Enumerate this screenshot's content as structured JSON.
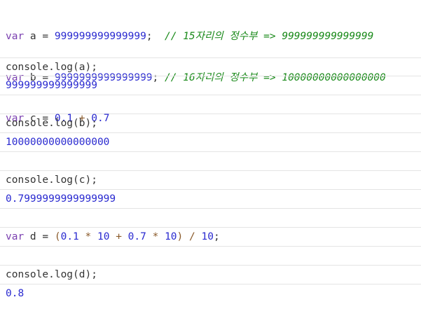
{
  "code": {
    "line_a": {
      "kw": "var",
      "name": " a = ",
      "value": "999999999999999",
      "semi": ";  ",
      "comment": "// 15자리의 정수부 => 999999999999999"
    },
    "line_b": {
      "kw": "var",
      "name": " b = ",
      "value": "9999999999999999",
      "semi": "; ",
      "comment": "// 16자리의 정수부 => 10000000000000000"
    },
    "line_c": {
      "kw": "var",
      "name": " c = ",
      "v1": "0.1",
      "op": " + ",
      "v2": "0.7"
    }
  },
  "console_entries": [
    {
      "input": "console.log(a);",
      "output": "999999999999999"
    },
    {
      "input": "console.log(b);",
      "output": "10000000000000000"
    },
    {
      "input": "console.log(c);",
      "output": "0.7999999999999999"
    }
  ],
  "code_d": {
    "kw": "var",
    "name": " d = ",
    "p1": "(",
    "v1": "0.1",
    "o1": " * ",
    "v2": "10",
    "o2": " + ",
    "v3": "0.7",
    "o3": " * ",
    "v4": "10",
    "p2": ") / ",
    "v5": "10",
    "semi": ";"
  },
  "console_d": {
    "input": "console.log(d);",
    "output": "0.8"
  },
  "colors": {
    "keyword": "#7a3fb0",
    "number": "#2a2ad0",
    "comment": "#1a8a1a",
    "operator": "#8a5a2a",
    "output": "#2a2ad0"
  }
}
